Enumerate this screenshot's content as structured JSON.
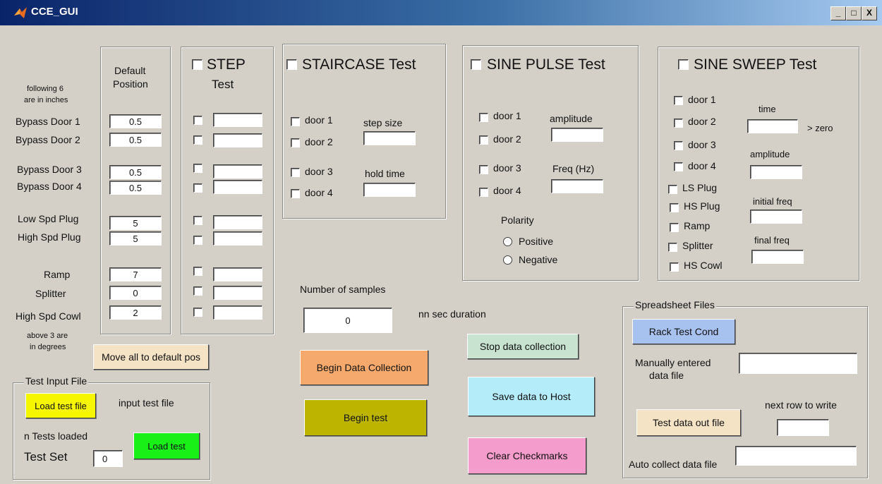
{
  "window": {
    "title": "CCE_GUI",
    "minimize": "_",
    "maximize": "□",
    "close": "X"
  },
  "default_position": {
    "header_top": "following 6",
    "header_bottom": "are in inches",
    "column_title_1": "Default",
    "column_title_2": "Position",
    "rows": [
      {
        "label": "Bypass Door 1",
        "value": "0.5"
      },
      {
        "label": "Bypass Door 2",
        "value": "0.5"
      },
      {
        "label": "Bypass Door 3",
        "value": "0.5"
      },
      {
        "label": "Bypass Door 4",
        "value": "0.5"
      },
      {
        "label": "Low Spd Plug",
        "value": "5"
      },
      {
        "label": "High Spd Plug",
        "value": "5"
      },
      {
        "label": "Ramp",
        "value": "7"
      },
      {
        "label": "Splitter",
        "value": "0"
      },
      {
        "label": "High Spd Cowl",
        "value": "2"
      }
    ],
    "footer_top": "above 3 are",
    "footer_bottom": "in degrees",
    "move_button": "Move all to default pos"
  },
  "step_test": {
    "title_1": "STEP",
    "title_2": "Test"
  },
  "staircase_test": {
    "title": "STAIRCASE Test",
    "doors": [
      "door 1",
      "door 2",
      "door 3",
      "door 4"
    ],
    "step_size_label": "step size",
    "hold_time_label": "hold time",
    "step_size_value": "",
    "hold_time_value": ""
  },
  "sine_pulse_test": {
    "title": "SINE PULSE Test",
    "doors": [
      "door 1",
      "door 2",
      "door 3",
      "door 4"
    ],
    "amplitude_label": "amplitude",
    "freq_label": "Freq  (Hz)",
    "polarity_label": "Polarity",
    "positive_label": "Positive",
    "negative_label": "Negative"
  },
  "sine_sweep_test": {
    "title": "SINE SWEEP Test",
    "items": [
      "door 1",
      "door 2",
      "door 3",
      "door 4",
      "LS Plug",
      "HS Plug",
      "Ramp",
      "Splitter",
      "HS Cowl"
    ],
    "time_label": "time",
    "zero_label": "> zero",
    "amplitude_label": "amplitude",
    "initial_freq_label": "initial freq",
    "final_freq_label": "final freq"
  },
  "samples": {
    "label": "Number of samples",
    "value": "0",
    "duration_label": "nn sec duration"
  },
  "buttons": {
    "begin_data_collection": "Begin Data Collection",
    "begin_test": "Begin test",
    "stop_data_collection": "Stop data collection",
    "save_data": "Save data to Host",
    "clear_checkmarks": "Clear Checkmarks"
  },
  "test_input_file": {
    "legend": "Test Input File",
    "load_file_button": "Load test file",
    "input_file_label": "input test file",
    "n_tests_label": "n Tests loaded",
    "test_set_label": "Test Set",
    "test_set_value": "0",
    "load_test_button": "Load test"
  },
  "spreadsheet_files": {
    "legend": "Spreadsheet Files",
    "rack_button": "Rack Test Cond",
    "manual_label_1": "Manually entered",
    "manual_label_2": "data file",
    "next_row_label": "next row to write",
    "test_data_out_button": "Test data out file",
    "auto_collect_label": "Auto collect data file"
  },
  "colors": {
    "background": "#d4d0c8",
    "rack_button": "#a8c2f0",
    "begin_data_collection": "#f6a96c",
    "begin_test": "#bdb400",
    "stop_data_collection": "#c8e4d0",
    "save_data": "#b4ecfa",
    "clear_checkmarks": "#f49ccc",
    "load_test_file": "#f6f600",
    "load_test": "#18f018",
    "move_default": "#f5e3c6",
    "test_data_out": "#f5e3c6"
  }
}
